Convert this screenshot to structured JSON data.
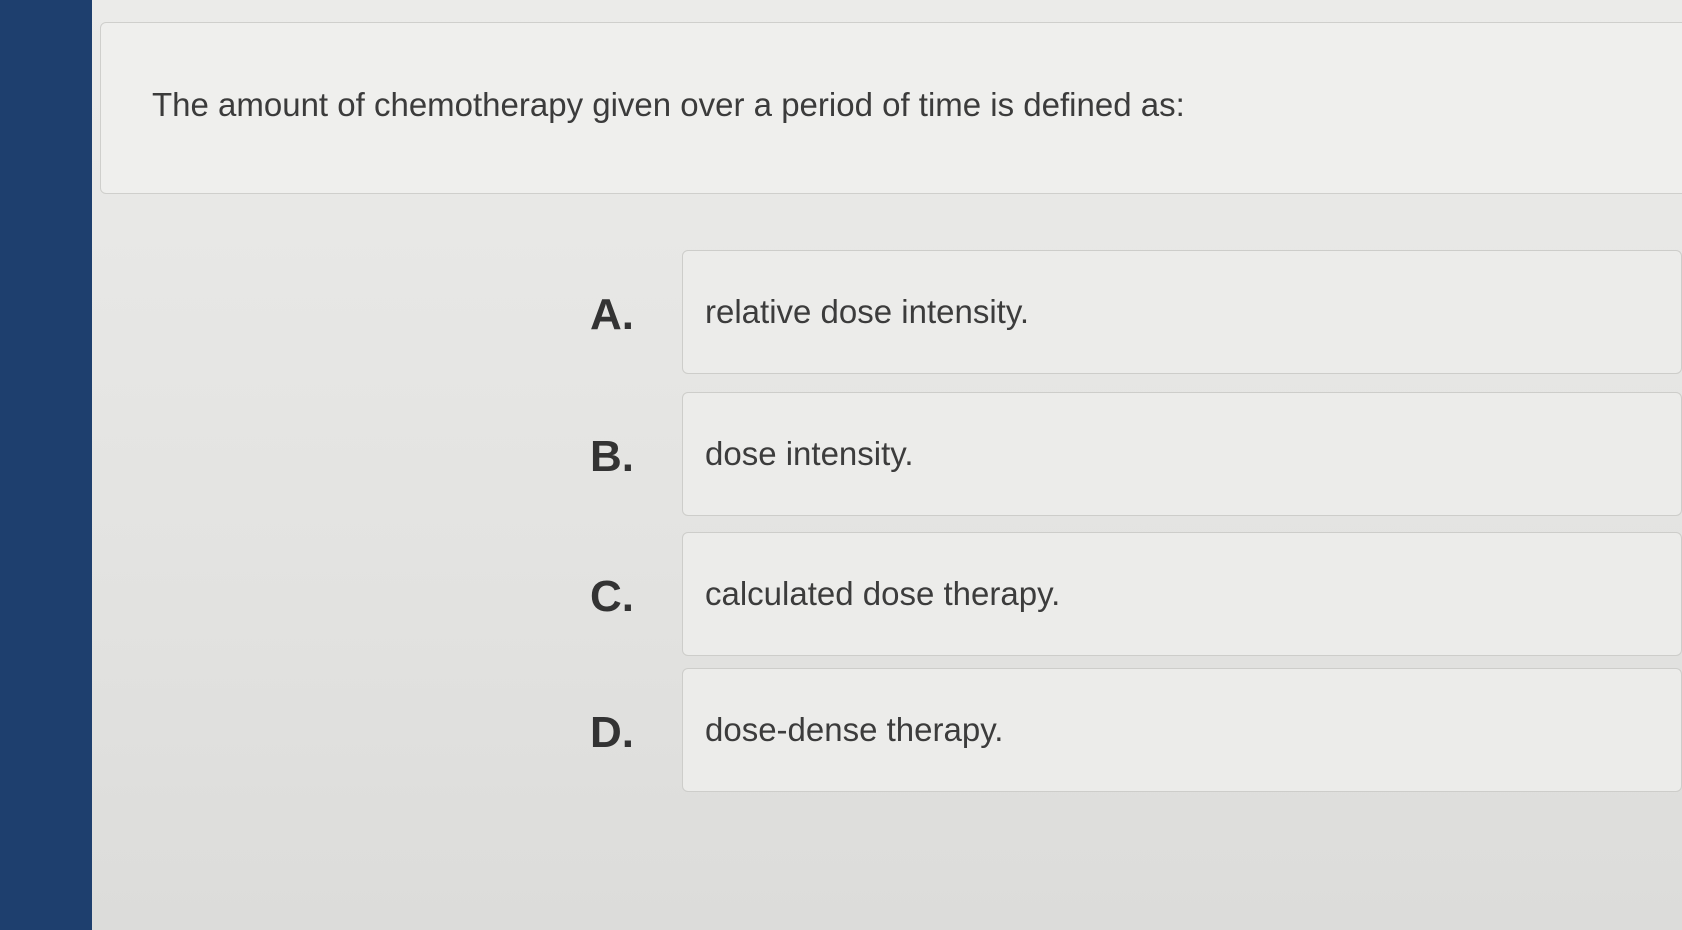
{
  "question": {
    "text": "The amount of chemotherapy given over a period of time is defined as:"
  },
  "options": [
    {
      "letter": "A.",
      "text": "relative dose intensity."
    },
    {
      "letter": "B.",
      "text": "dose intensity."
    },
    {
      "letter": "C.",
      "text": "calculated dose therapy."
    },
    {
      "letter": "D.",
      "text": "dose-dense therapy."
    }
  ],
  "colors": {
    "sidebar": "#1e3f6e",
    "background": "#e4e4e2",
    "card": "#ececea",
    "text": "#3a3a3a"
  }
}
